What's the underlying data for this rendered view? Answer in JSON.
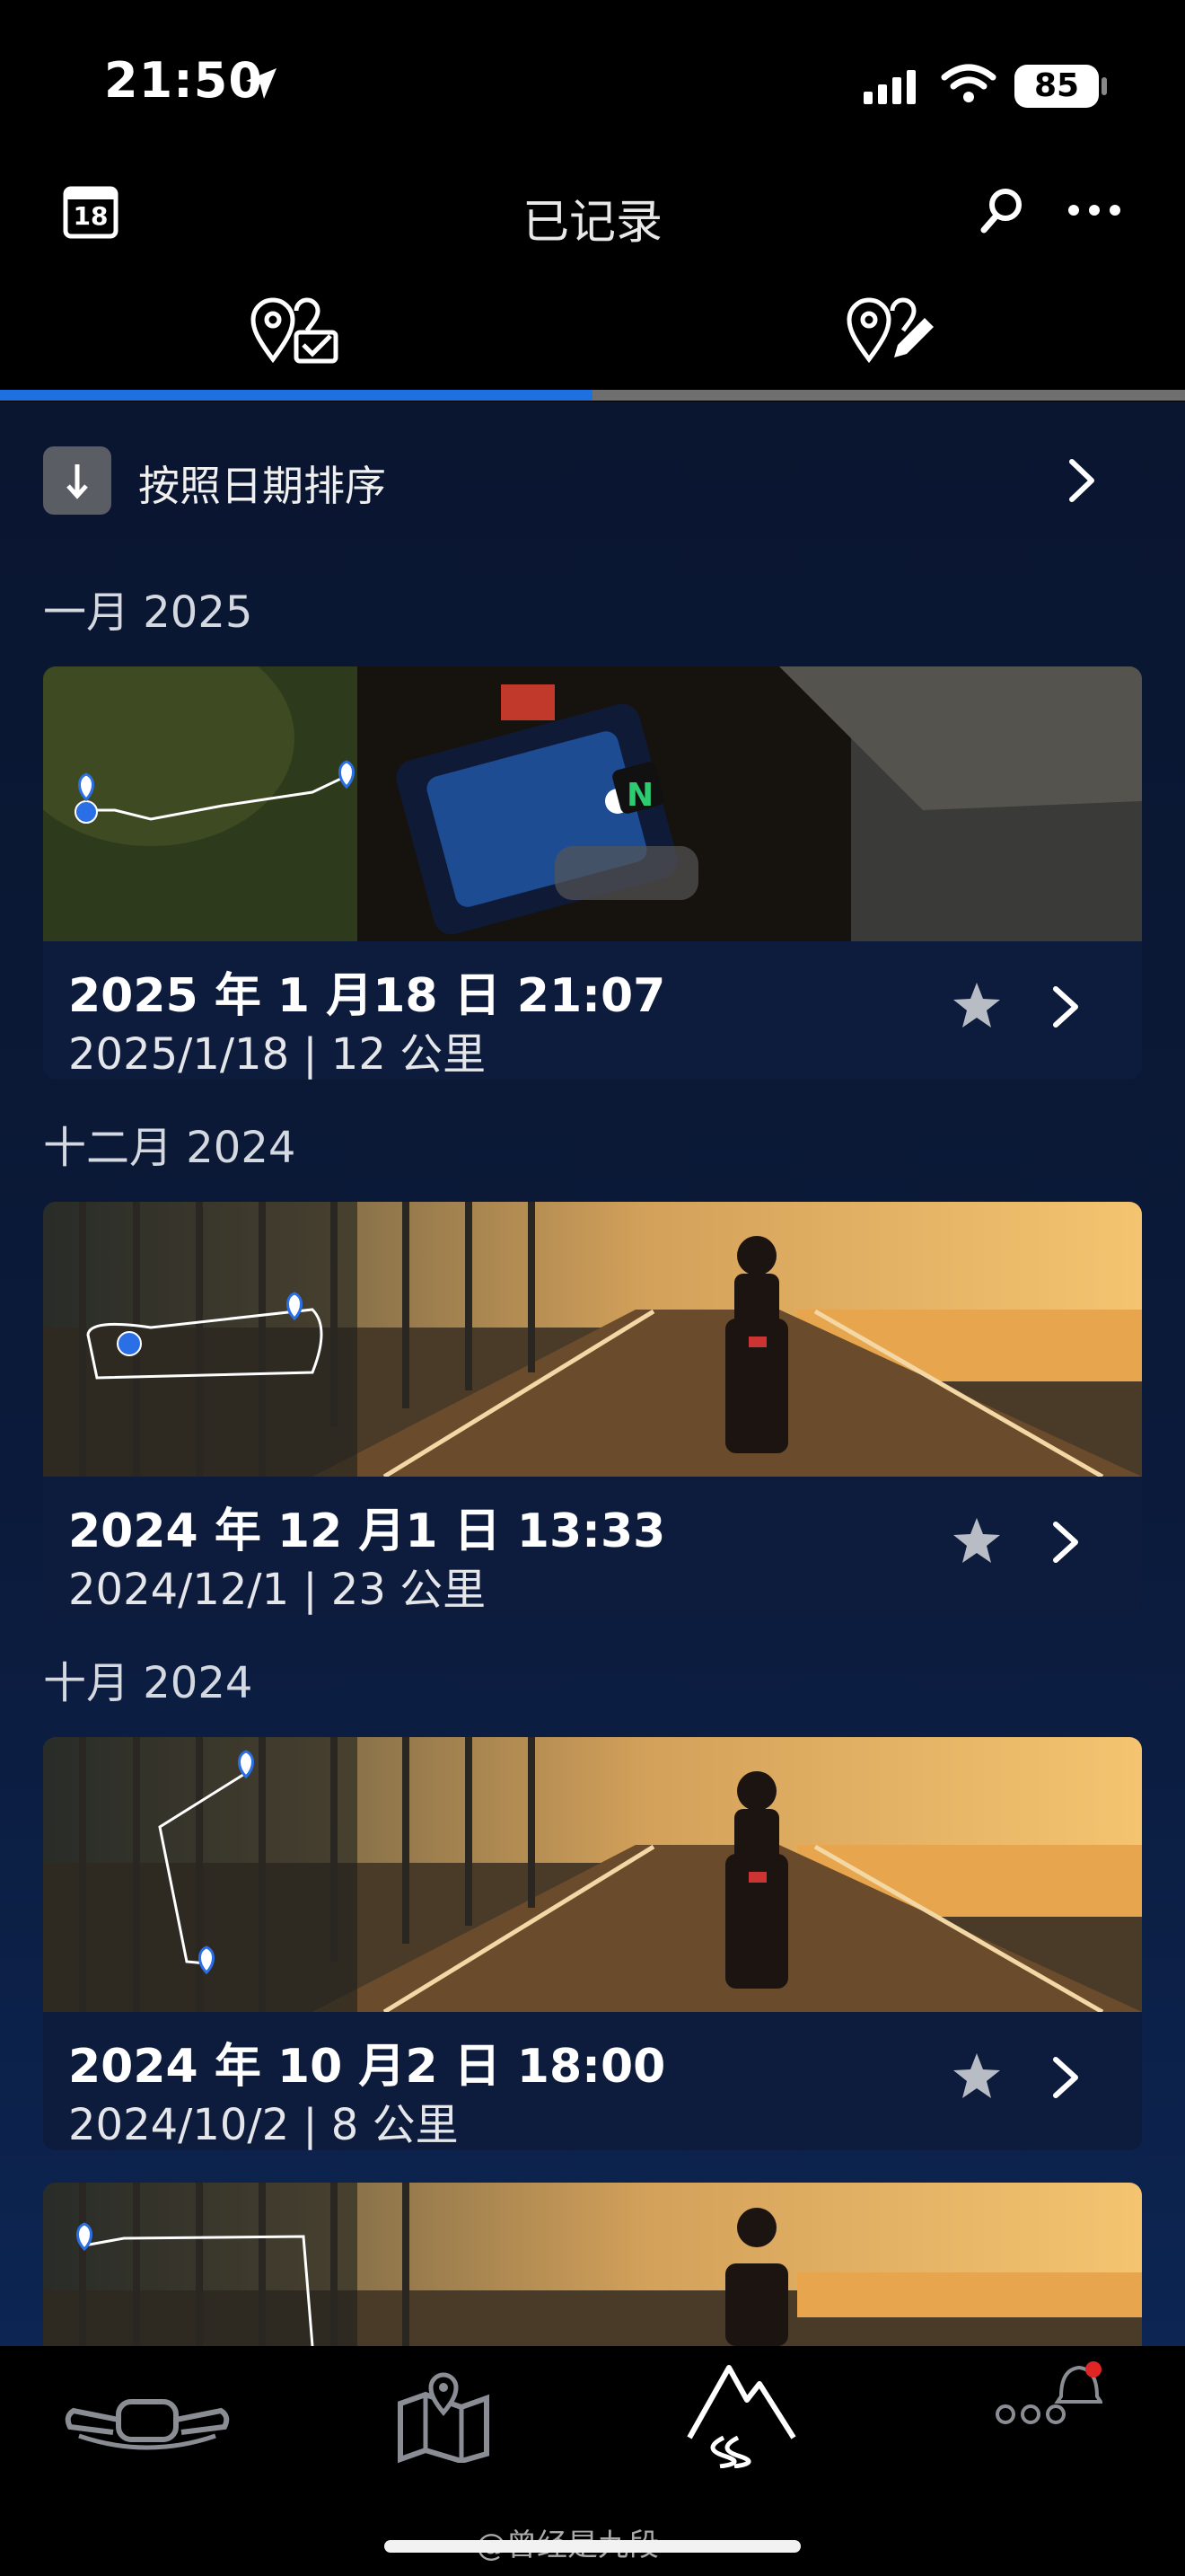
{
  "status": {
    "time": "21:50",
    "battery": "85"
  },
  "header": {
    "title": "已记录",
    "calendar_day": "18"
  },
  "sort": {
    "label": "按照日期排序"
  },
  "sections": [
    {
      "month": "一月 2025",
      "title": "2025 年 1 月18 日 21:07",
      "subtitle": "2025/1/18 | 12 公里"
    },
    {
      "month": "十二月 2024",
      "title": "2024 年 12 月1 日 13:33",
      "subtitle": "2024/12/1 | 23 公里"
    },
    {
      "month": "十月 2024",
      "title": "2024 年 10 月2 日 18:00",
      "subtitle": "2024/10/2 | 8 公里"
    }
  ],
  "watermark": "@曾经是九段",
  "icons": {
    "tab1": "map-pin-check-icon",
    "tab2": "map-pin-edit-icon",
    "nav": [
      "motorcycle-icon",
      "map-icon",
      "mountain-route-icon",
      "more-notification-icon"
    ]
  },
  "colors": {
    "accent": "#1e6fe0",
    "route_pin": "#2b6fe6"
  }
}
